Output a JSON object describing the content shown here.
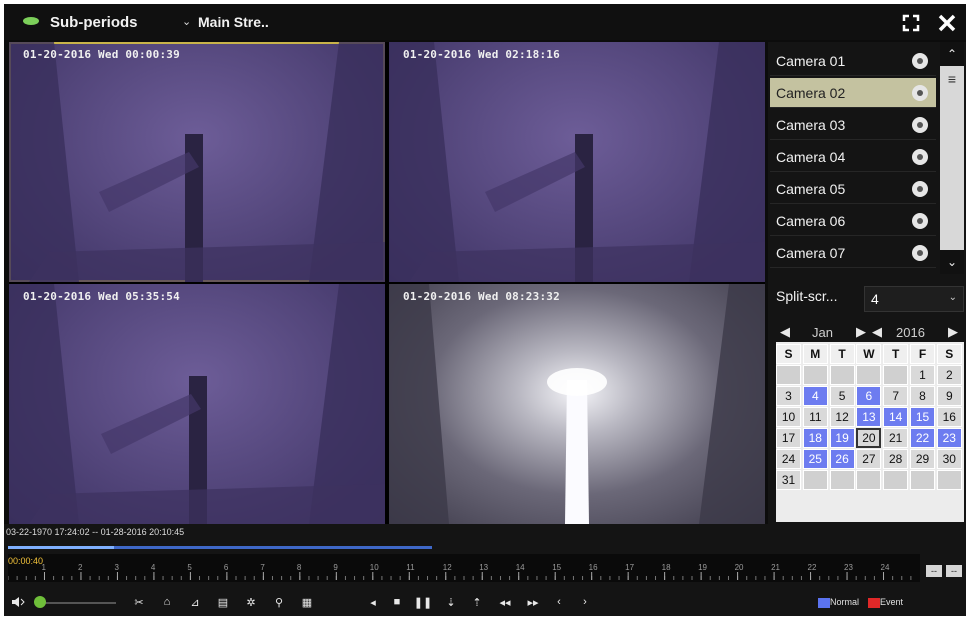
{
  "toolbar": {
    "mode_label": "Sub-periods",
    "stream_label": "Main Stre..",
    "fullscreen_icon": "fullscreen-icon",
    "close_icon": "close-icon"
  },
  "channels": [
    {
      "osd": "01-20-2016 Wed 00:00:39",
      "selected": true
    },
    {
      "osd": "01-20-2016 Wed 02:18:16",
      "selected": false
    },
    {
      "osd": "01-20-2016 Wed 05:35:54",
      "selected": false
    },
    {
      "osd": "01-20-2016 Wed 08:23:32",
      "selected": false
    }
  ],
  "camera_list": [
    {
      "label": "Camera 01",
      "selected": false
    },
    {
      "label": "Camera 02",
      "selected": true
    },
    {
      "label": "Camera 03",
      "selected": false
    },
    {
      "label": "Camera 04",
      "selected": false
    },
    {
      "label": "Camera 05",
      "selected": false
    },
    {
      "label": "Camera 06",
      "selected": false
    },
    {
      "label": "Camera 07",
      "selected": false
    }
  ],
  "split_screen": {
    "label": "Split-scr...",
    "value": "4"
  },
  "calendar": {
    "month": "Jan",
    "year": "2016",
    "weekdays": [
      "S",
      "M",
      "T",
      "W",
      "T",
      "F",
      "S"
    ],
    "weeks": [
      [
        "",
        "",
        "",
        "",
        "",
        "1",
        "2"
      ],
      [
        "3",
        "4",
        "5",
        "6",
        "7",
        "8",
        "9"
      ],
      [
        "10",
        "11",
        "12",
        "13",
        "14",
        "15",
        "16"
      ],
      [
        "17",
        "18",
        "19",
        "20",
        "21",
        "22",
        "23"
      ],
      [
        "24",
        "25",
        "26",
        "27",
        "28",
        "29",
        "30"
      ],
      [
        "31",
        "",
        "",
        "",
        "",
        "",
        ""
      ]
    ],
    "recorded_days": [
      "4",
      "6",
      "13",
      "14",
      "15",
      "18",
      "19",
      "22",
      "23",
      "25",
      "26"
    ],
    "selected_day": "20"
  },
  "timeline": {
    "range": "03-22-1970 17:24:02 -- 01-28-2016 20:10:45",
    "current_time": "00:00:40",
    "hours": [
      "1",
      "2",
      "3",
      "4",
      "5",
      "6",
      "7",
      "8",
      "9",
      "10",
      "11",
      "12",
      "13",
      "14",
      "15",
      "16",
      "17",
      "18",
      "19",
      "20",
      "21",
      "22",
      "23",
      "24"
    ],
    "progress": 0.25
  },
  "controls": {
    "volume_icon": "speaker-icon",
    "tools": [
      "clip-icon",
      "tag-icon",
      "custom-tag-icon",
      "manage-tags-icon",
      "smart-icon",
      "zoom-icon",
      "file-management-icon"
    ],
    "playback": [
      "reverse-play-icon",
      "stop-icon",
      "pause-icon",
      "slow-icon",
      "fast-icon",
      "rewind-30s-icon",
      "forward-30s-icon",
      "prev-icon",
      "next-icon"
    ],
    "zoom_in": "--",
    "zoom_out": "--"
  },
  "legend": {
    "normal_label": "Normal",
    "event_label": "Event",
    "normal_color": "#5b73f0",
    "event_color": "#e02828"
  }
}
